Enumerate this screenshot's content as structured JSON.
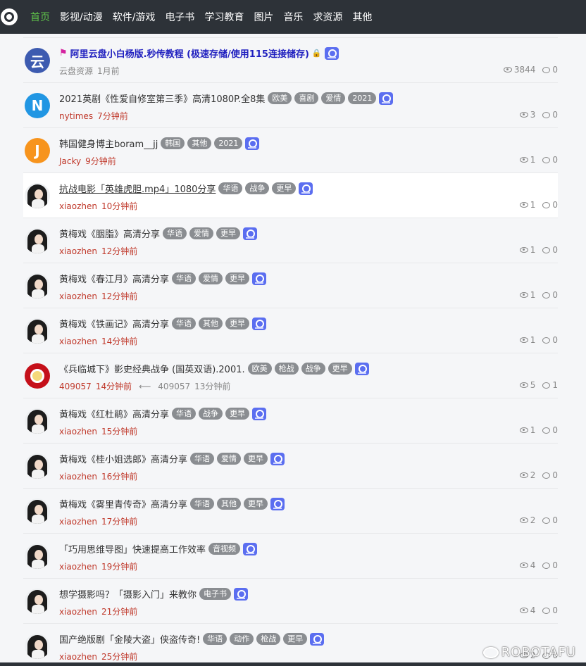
{
  "nav": {
    "items": [
      "首页",
      "影视/动漫",
      "软件/游戏",
      "电子书",
      "学习教育",
      "图片",
      "音乐",
      "求资源",
      "其他"
    ],
    "active_index": 0
  },
  "threads": [
    {
      "kind": "pinned",
      "avatar_letter": "云",
      "avatar_color": "#3d5bb0",
      "title": "阿里云盘小白杨版.秒传教程 (极速存储/使用115连接储存)",
      "tags": [],
      "author": "云盘资源",
      "time": "1月前",
      "views": "3844",
      "replies": "0"
    },
    {
      "kind": "letter",
      "avatar_letter": "N",
      "avatar_color": "#2196e3",
      "title": "2021英剧《性爱自修室第三季》高清1080P.全8集",
      "tags": [
        "欧美",
        "喜剧",
        "爱情",
        "2021"
      ],
      "author": "nytimes",
      "time": "7分钟前",
      "views": "3",
      "replies": "0"
    },
    {
      "kind": "letter",
      "avatar_letter": "J",
      "avatar_color": "#f7941d",
      "title": "韩国健身博主boram__jj",
      "tags": [
        "韩国",
        "其他",
        "2021"
      ],
      "author": "Jacky",
      "time": "9分钟前",
      "views": "1",
      "replies": "0"
    },
    {
      "kind": "person",
      "highlight": true,
      "title": "抗战电影「英雄虎胆.mp4」1080分享",
      "tags": [
        "华语",
        "战争",
        "更早"
      ],
      "author": "xiaozhen",
      "time": "10分钟前",
      "views": "1",
      "replies": "0"
    },
    {
      "kind": "person",
      "title": "黄梅戏《胭脂》高清分享",
      "tags": [
        "华语",
        "爱情",
        "更早"
      ],
      "author": "xiaozhen",
      "time": "12分钟前",
      "views": "1",
      "replies": "0"
    },
    {
      "kind": "person",
      "title": "黄梅戏《春江月》高清分享",
      "tags": [
        "华语",
        "爱情",
        "更早"
      ],
      "author": "xiaozhen",
      "time": "12分钟前",
      "views": "1",
      "replies": "0"
    },
    {
      "kind": "person",
      "title": "黄梅戏《铁画记》高清分享",
      "tags": [
        "华语",
        "其他",
        "更早"
      ],
      "author": "xiaozhen",
      "time": "14分钟前",
      "views": "1",
      "replies": "0"
    },
    {
      "kind": "ring",
      "title": "《兵临城下》影史经典战争 (国英双语).2001.",
      "tags": [
        "欧美",
        "枪战",
        "战争",
        "更早"
      ],
      "author": "409057",
      "time": "14分钟前",
      "reply_author": "409057",
      "reply_time": "13分钟前",
      "views": "5",
      "replies": "1"
    },
    {
      "kind": "person",
      "title": "黄梅戏《红杜鹃》高清分享",
      "tags": [
        "华语",
        "战争",
        "更早"
      ],
      "author": "xiaozhen",
      "time": "15分钟前",
      "views": "1",
      "replies": "0"
    },
    {
      "kind": "person",
      "title": "黄梅戏《桂小姐选郎》高清分享",
      "tags": [
        "华语",
        "爱情",
        "更早"
      ],
      "author": "xiaozhen",
      "time": "16分钟前",
      "views": "2",
      "replies": "0"
    },
    {
      "kind": "person",
      "title": "黄梅戏《雾里青传奇》高清分享",
      "tags": [
        "华语",
        "其他",
        "更早"
      ],
      "author": "xiaozhen",
      "time": "17分钟前",
      "views": "2",
      "replies": "0"
    },
    {
      "kind": "person",
      "title": "「巧用思维导图」快速提高工作效率",
      "tags": [
        "音视频"
      ],
      "author": "xiaozhen",
      "time": "19分钟前",
      "views": "4",
      "replies": "0"
    },
    {
      "kind": "person",
      "title": "想学摄影吗？「摄影入门」来教你",
      "tags": [
        "电子书"
      ],
      "author": "xiaozhen",
      "time": "21分钟前",
      "views": "4",
      "replies": "0"
    },
    {
      "kind": "person",
      "title": "国产绝版剧「金陵大盗」侠盗传奇!",
      "tags": [
        "华语",
        "动作",
        "枪战",
        "更早"
      ],
      "author": "xiaozhen",
      "time": "25分钟前",
      "views": "2",
      "replies": "0"
    }
  ],
  "watermark": "ROBOTAFU"
}
